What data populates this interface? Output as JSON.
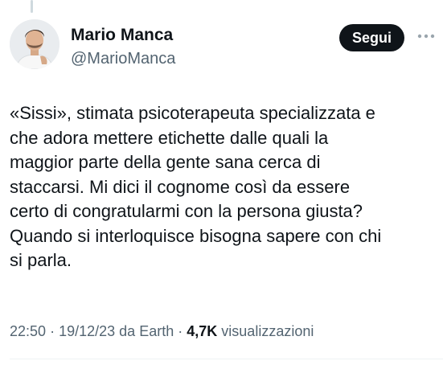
{
  "tweet": {
    "author": {
      "display_name": "Mario Manca",
      "handle": "@MarioManca",
      "avatar_icon": "profile-photo"
    },
    "follow_label": "Segui",
    "more_icon": "more-dots-icon",
    "text": "«Sissi», stimata psicoterapeuta specializzata e\nche adora mettere etichette dalle quali la\nmaggior parte della gente sana cerca di\nstaccarsi. Mi dici il cognome così da essere\ncerto di congratularmi con la persona giusta?\nQuando si interloquisce bisogna sapere con chi\nsi parla.",
    "time": "22:50",
    "date": "19/12/23",
    "source": "da Earth",
    "separator": "·",
    "views_count": "4,7K",
    "views_label": "visualizzazioni"
  },
  "colors": {
    "text_primary": "#0f1419",
    "text_secondary": "#536471",
    "button_bg": "#0f1419",
    "button_text": "#ffffff",
    "divider": "#eff3f4"
  }
}
